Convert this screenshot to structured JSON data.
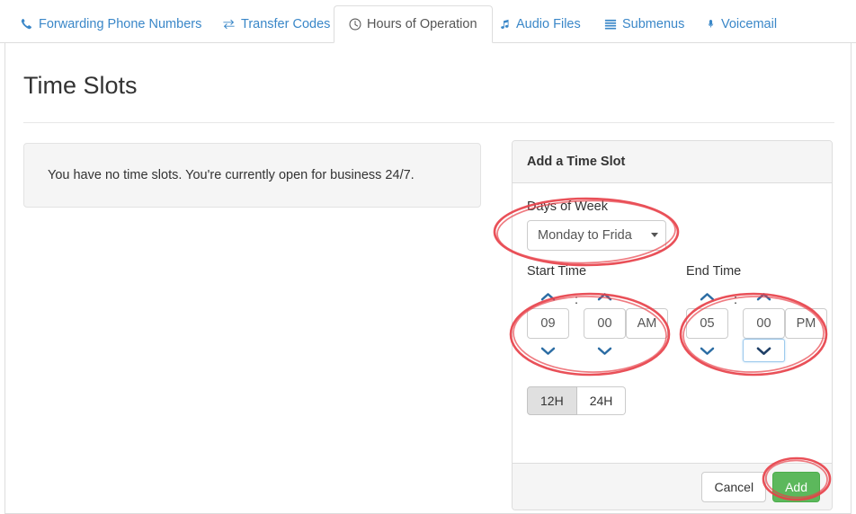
{
  "tabs": [
    {
      "label": "Forwarding Phone Numbers",
      "icon": "phone-icon",
      "active": false
    },
    {
      "label": "Transfer Codes",
      "icon": "exchange-icon",
      "active": false
    },
    {
      "label": "Hours of Operation",
      "icon": "clock-icon",
      "active": true
    },
    {
      "label": "Audio Files",
      "icon": "music-note-icon",
      "active": false
    },
    {
      "label": "Submenus",
      "icon": "list-icon",
      "active": false
    },
    {
      "label": "Voicemail",
      "icon": "microphone-icon",
      "active": false
    }
  ],
  "page": {
    "title": "Time Slots",
    "empty_message": "You have no time slots. You're currently open for business 24/7."
  },
  "panel": {
    "title": "Add a Time Slot",
    "days_label": "Days of Week",
    "days_value": "Monday to Frida",
    "start_label": "Start Time",
    "end_label": "End Time",
    "start_hour": "09",
    "start_minute": "00",
    "start_meridiem": "AM",
    "end_hour": "05",
    "end_minute": "00",
    "end_meridiem": "PM",
    "colon": ":",
    "format_12h": "12H",
    "format_24h": "24H",
    "format_selected": "12H",
    "cancel_label": "Cancel",
    "add_label": "Add"
  },
  "colors": {
    "tab_link": "#3a87c8",
    "active_tab_text": "#555555",
    "panel_border": "#dddddd",
    "panel_header_bg": "#f5f5f5",
    "add_button_bg": "#5cb85c",
    "annotation_red": "#e8414a",
    "focus_blue": "#9ecaed",
    "arrow_blue": "#2b6ca3"
  },
  "annotations": {
    "shape": "hand-drawn-ellipse",
    "color": "#e8414a",
    "targets": [
      "days-of-week-field",
      "start-time-spinner",
      "end-time-spinner",
      "add-button"
    ]
  }
}
